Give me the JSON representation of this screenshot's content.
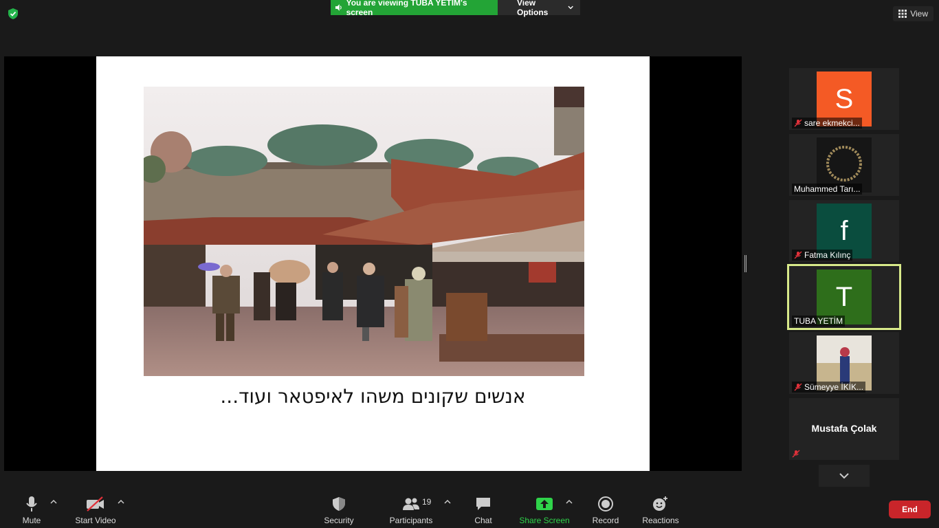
{
  "top": {
    "viewing_text": "You are viewing TUBA YETİM's screen",
    "view_options_label": "View Options",
    "view_label": "View"
  },
  "slide": {
    "caption": "אנשים שקונים משהו לאיפטאר ועוד..."
  },
  "gallery": [
    {
      "initial": "S",
      "name": "sare ekmekci...",
      "color": "#f45a25",
      "muted": true
    },
    {
      "initial": "",
      "name": "Muhammed Tarı...",
      "color": "#1b1b1b",
      "muted": false
    },
    {
      "initial": "f",
      "name": "Fatma Kılınç",
      "color": "#0a4d3e",
      "muted": true
    },
    {
      "initial": "T",
      "name": "TUBA YETİM",
      "color": "#2e6e1b",
      "muted": false,
      "active": true
    },
    {
      "initial": "",
      "name": "Sümeyye İKİK...",
      "color": "#c9b99b",
      "muted": true
    },
    {
      "initial": "",
      "name": "Mustafa Çolak",
      "color": "#232323",
      "muted": true
    }
  ],
  "toolbar": {
    "mute": "Mute",
    "start_video": "Start Video",
    "security": "Security",
    "participants": "Participants",
    "participants_count": "19",
    "chat": "Chat",
    "share_screen": "Share Screen",
    "record": "Record",
    "reactions": "Reactions",
    "end": "End"
  },
  "colors": {
    "share_green": "#23a436",
    "end_red": "#c9252a",
    "active_border": "#d8ea8a"
  }
}
